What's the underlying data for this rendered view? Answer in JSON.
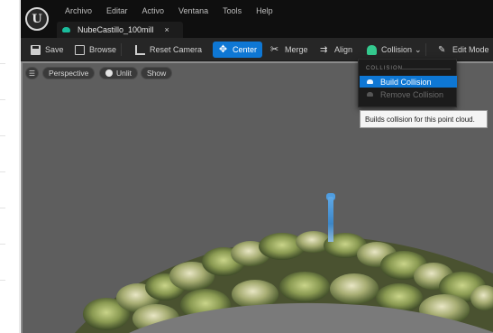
{
  "menubar": {
    "items": [
      "Archivo",
      "Editar",
      "Activo",
      "Ventana",
      "Tools",
      "Help"
    ]
  },
  "logo_glyph": "U",
  "asset_tab": {
    "label": "NubeCastillo_100mill",
    "close": "×",
    "icon": "point-cloud-icon",
    "icon_color": "#1abc9c"
  },
  "toolbar": {
    "save_label": "Save",
    "browse_label": "Browse",
    "reset_camera_label": "Reset Camera",
    "center_label": "Center",
    "merge_label": "Merge",
    "align_label": "Align",
    "collision_label": "Collision",
    "collision_chevron": "⌄",
    "edit_mode_label": "Edit Mode",
    "accent_color": "#0e77d4",
    "collision_icon_color": "#34c98e"
  },
  "viewport": {
    "menu_glyph": "☰",
    "perspective_label": "Perspective",
    "unlit_label": "Unlit",
    "show_label": "Show",
    "background_color": "#5e5e5e"
  },
  "collision_menu": {
    "section_label": "COLLISION",
    "items": [
      {
        "label": "Build Collision",
        "state": "highlighted"
      },
      {
        "label": "Remove Collision",
        "state": "disabled"
      }
    ]
  },
  "tooltip": {
    "text": "Builds collision for this point cloud."
  }
}
